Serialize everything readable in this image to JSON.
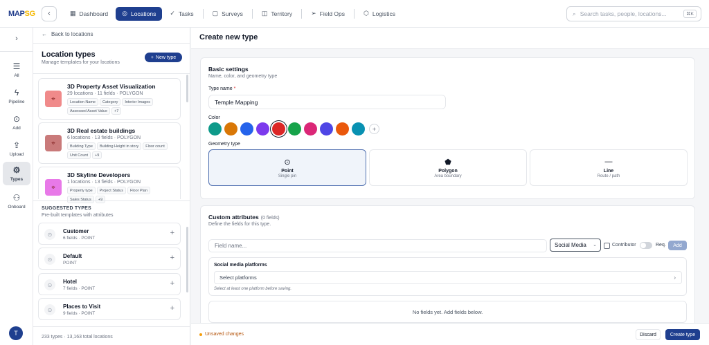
{
  "app": {
    "logo_main": "MAP",
    "logo_accent": "SG"
  },
  "nav": {
    "items": [
      {
        "label": "Dashboard",
        "icon": "dashboard-icon"
      },
      {
        "label": "Locations",
        "icon": "location-pin-icon"
      },
      {
        "label": "Tasks",
        "icon": "check-icon"
      },
      {
        "label": "Surveys",
        "icon": "clipboard-icon"
      },
      {
        "label": "Territory",
        "icon": "map-icon"
      },
      {
        "label": "Field Ops",
        "icon": "send-icon"
      },
      {
        "label": "Logistics",
        "icon": "box-icon"
      }
    ],
    "active": "Locations"
  },
  "search": {
    "placeholder": "Search tasks, people, locations...",
    "shortcut": "⌘K"
  },
  "rail": {
    "items": [
      {
        "label": "All",
        "icon": "list-icon"
      },
      {
        "label": "Pipeline",
        "icon": "lightning-icon"
      },
      {
        "label": "Add",
        "icon": "pin-icon"
      },
      {
        "label": "Upload",
        "icon": "upload-icon"
      },
      {
        "label": "Types",
        "icon": "gear-icon"
      },
      {
        "label": "Onboard",
        "icon": "users-icon"
      }
    ],
    "active": "Types",
    "user_initial": "T"
  },
  "sidebar": {
    "back_label": "Back to locations",
    "title": "Location types",
    "subtitle": "Manage templates for your locations",
    "new_button": "New type",
    "types": [
      {
        "name": "3D Property Asset Visualization",
        "meta": "29 locations · 11 fields · POLYGON",
        "tags": [
          "Location Name",
          "Category",
          "Interior Images",
          "Assessed Asset Value",
          "+7"
        ],
        "color": "#f08a8a"
      },
      {
        "name": "3D Real estate buildings",
        "meta": "6 locations · 13 fields · POLYGON",
        "tags": [
          "Building Type",
          "Building Height in story",
          "Floor count",
          "Unit Count",
          "+9"
        ],
        "color": "#c97a7a"
      },
      {
        "name": "3D Skyline Developers",
        "meta": "1 locations · 13 fields · POLYGON",
        "tags": [
          "Property type",
          "Project Status",
          "Floor Plan",
          "Sales Status",
          "+9"
        ],
        "color": "#e879e8"
      }
    ],
    "suggested_title": "SUGGESTED TYPES",
    "suggested_subtitle": "Pre-built templates with attributes",
    "suggested": [
      {
        "name": "Customer",
        "meta": "6 fields · POINT"
      },
      {
        "name": "Default",
        "meta": "POINT"
      },
      {
        "name": "Hotel",
        "meta": "7 fields · POINT"
      },
      {
        "name": "Places to Visit",
        "meta": "9 fields · POINT"
      }
    ],
    "footer": "233 types · 13,163 total locations"
  },
  "main": {
    "title": "Create new type",
    "basic": {
      "title": "Basic settings",
      "subtitle": "Name, color, and geometry type",
      "type_name_label": "Type name",
      "type_name_value": "Temple Mapping",
      "color_label": "Color",
      "colors": [
        "#0e9a8a",
        "#d97706",
        "#2563eb",
        "#7c3aed",
        "#dc2626",
        "#16a34a",
        "#db2777",
        "#4f46e5",
        "#ea580c",
        "#0891b2"
      ],
      "selected_color": 4,
      "geometry_label": "Geometry type",
      "geometry": [
        {
          "name": "Point",
          "sub": "Single pin",
          "icon": "pin-icon"
        },
        {
          "name": "Polygon",
          "sub": "Area boundary",
          "icon": "pentagon-icon"
        },
        {
          "name": "Line",
          "sub": "Route / path",
          "icon": "line-icon"
        }
      ],
      "selected_geometry": "Point"
    },
    "custom": {
      "title": "Custom attributes",
      "count": "(0 fields)",
      "subtitle": "Define the fields for this type.",
      "field_placeholder": "Field name...",
      "field_type": "Social Media",
      "contributor_label": "Contributor",
      "req_label": "Req.",
      "add_button": "Add",
      "platforms_title": "Social media platforms",
      "platforms_placeholder": "Select platforms",
      "platforms_hint": "Select at least one platform before saving.",
      "empty_text": "No fields yet. Add fields below."
    }
  },
  "footer": {
    "unsaved": "Unsaved changes",
    "discard": "Discard",
    "create": "Create type"
  }
}
